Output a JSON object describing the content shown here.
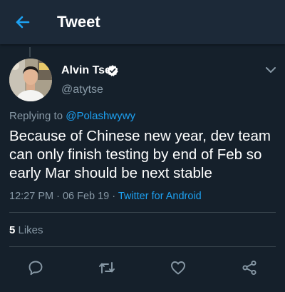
{
  "header": {
    "back_icon": "arrow-left-icon",
    "title": "Tweet"
  },
  "tweet": {
    "author_name": "Alvin Tse",
    "verified_icon": "verified-badge-icon",
    "handle": "@atytse",
    "replying_prefix": "Replying to ",
    "replying_to": "@Polashwywy",
    "text": "Because of Chinese new year, dev team can only finish testing by end of Feb so early Mar should be next stable",
    "time": "12:27 PM · 06 Feb 19 · ",
    "source": "Twitter for Android",
    "likes_count": "5",
    "likes_label": " Likes"
  },
  "actions": [
    {
      "name": "reply",
      "icon": "comment-icon"
    },
    {
      "name": "retweet",
      "icon": "retweet-icon"
    },
    {
      "name": "like",
      "icon": "heart-icon"
    },
    {
      "name": "share",
      "icon": "share-icon"
    }
  ],
  "colors": {
    "background": "#15202b",
    "header": "#1c2938",
    "accent": "#1da1f2",
    "secondary_text": "#8899a6",
    "divider": "#38444d"
  }
}
